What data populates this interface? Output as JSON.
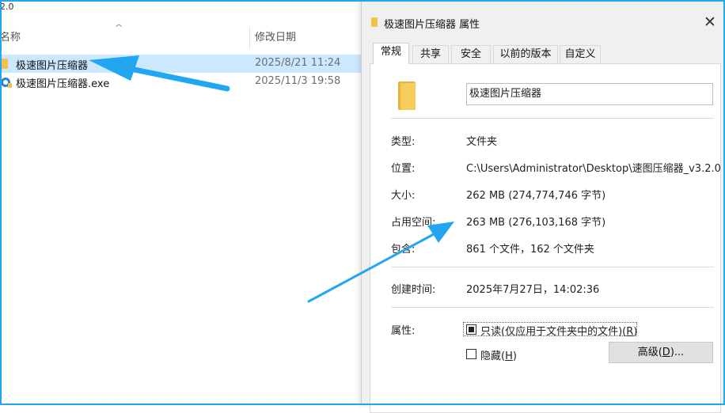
{
  "explorer": {
    "path_fragment": "2.0",
    "columns": {
      "name": "名称",
      "date_modified": "修改日期"
    },
    "rows": [
      {
        "name": "极速图片压缩器",
        "date": "2025/8/21 11:24",
        "icon": "folder-icon",
        "selected": true
      },
      {
        "name": "极速图片压缩器.exe",
        "date": "2025/11/3 19:58",
        "icon": "exe-icon",
        "selected": false
      }
    ]
  },
  "dialog": {
    "title": "极速图片压缩器 属性",
    "tabs": [
      "常规",
      "共享",
      "安全",
      "以前的版本",
      "自定义"
    ],
    "active_tab": "常规",
    "folder_name": "极速图片压缩器",
    "fields": {
      "type_label": "类型:",
      "type_value": "文件夹",
      "location_label": "位置:",
      "location_value": "C:\\Users\\Administrator\\Desktop\\速图压缩器_v3.2.0",
      "size_label": "大小:",
      "size_value": "262 MB (274,774,746 字节)",
      "disk_label": "占用空间:",
      "disk_value": "263 MB (276,103,168 字节)",
      "contains_label": "包含:",
      "contains_value": "861 个文件，162 个文件夹",
      "created_label": "创建时间:",
      "created_value": "2025年7月27日，14:02:36",
      "attributes_label": "属性:"
    },
    "attributes": {
      "readonly_label": "只读(仅应用于文件夹中的文件)(",
      "readonly_key": "R",
      "readonly_suffix": ")",
      "readonly_state": "indeterminate",
      "hidden_label": "隐藏(",
      "hidden_key": "H",
      "hidden_suffix": ")",
      "hidden_checked": false,
      "advanced_label": "高级(",
      "advanced_key": "D",
      "advanced_suffix": ")..."
    }
  },
  "annotation_color": "#22a6f2"
}
